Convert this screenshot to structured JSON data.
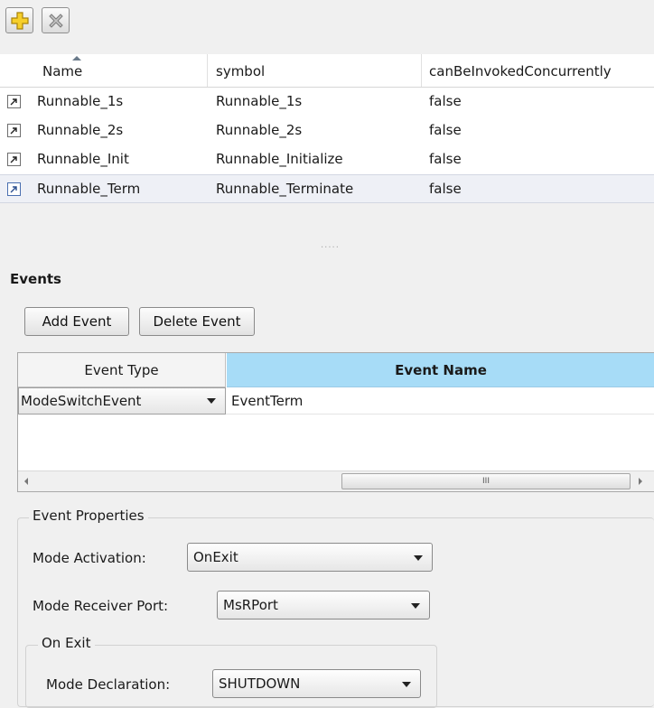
{
  "toolbar": {
    "add_icon": "add-plus-icon",
    "delete_icon": "delete-x-icon"
  },
  "runnables": {
    "columns": [
      "Name",
      "symbol",
      "canBeInvokedConcurrently"
    ],
    "rows": [
      {
        "name": "Runnable_1s",
        "symbol": "Runnable_1s",
        "concurrent": "false"
      },
      {
        "name": "Runnable_2s",
        "symbol": "Runnable_2s",
        "concurrent": "false"
      },
      {
        "name": "Runnable_Init",
        "symbol": "Runnable_Initialize",
        "concurrent": "false"
      },
      {
        "name": "Runnable_Term",
        "symbol": "Runnable_Terminate",
        "concurrent": "false"
      }
    ]
  },
  "splitter": {
    "grip": "....."
  },
  "events": {
    "title": "Events",
    "add_label": "Add Event",
    "delete_label": "Delete Event",
    "grid": {
      "type_header": "Event Type",
      "name_header": "Event Name",
      "row": {
        "type": "ModeSwitchEvent",
        "name": "EventTerm"
      }
    },
    "scroll_grip": "III"
  },
  "properties": {
    "legend": "Event Properties",
    "mode_activation_label": "Mode Activation:",
    "mode_activation_value": "OnExit",
    "receiver_port_label": "Mode Receiver Port:",
    "receiver_port_value": "MsRPort",
    "on_exit": {
      "legend": "On Exit",
      "declaration_label": "Mode Declaration:",
      "declaration_value": "SHUTDOWN"
    }
  },
  "colors": {
    "header_highlight": "#a7dcf7",
    "selected_row": "#eef0f6",
    "add_icon": "#f2c318",
    "background": "#f0f0f0"
  }
}
